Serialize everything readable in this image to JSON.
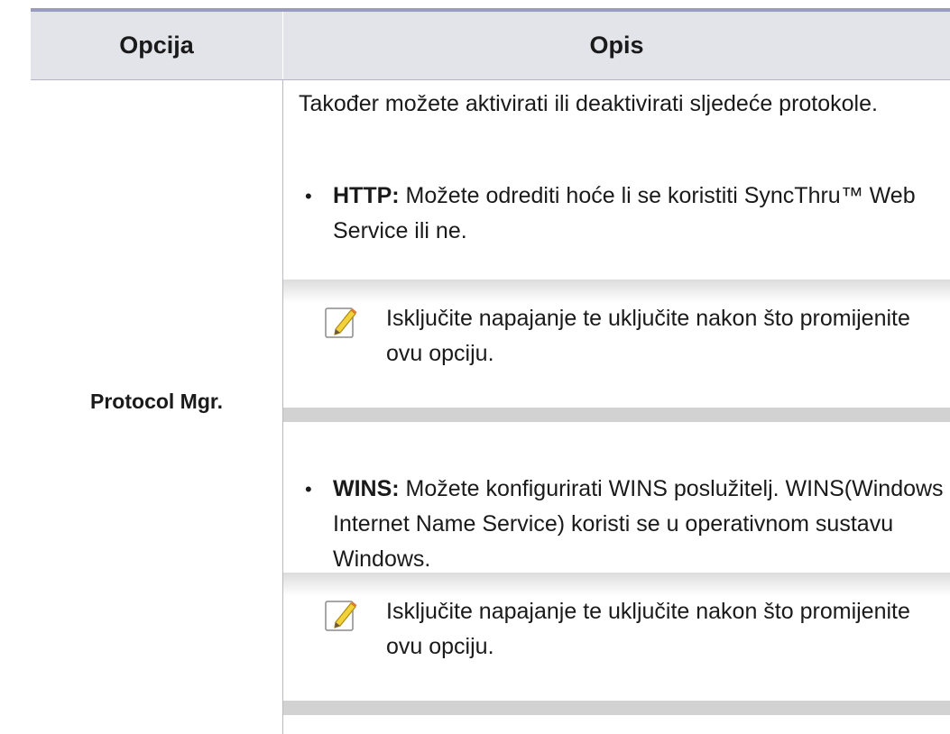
{
  "table": {
    "header": {
      "col1": "Opcija",
      "col2": "Opis"
    },
    "row": {
      "option": "Protocol Mgr.",
      "intro": "Također možete aktivirati ili deaktivirati sljedeće protokole.",
      "items": [
        {
          "label": "HTTP:",
          "text": " Možete odrediti hoće li se koristiti SyncThru™ Web Service ili ne.",
          "note": "Isključite napajanje te uključite nakon što promijenite ovu opciju."
        },
        {
          "label": "WINS:",
          "text": " Možete konfigurirati WINS poslužitelj. WINS(Windows Internet Name Service) koristi se u operativnom sustavu Windows.",
          "note": "Isključite napajanje te uključite nakon što promijenite ovu opciju."
        }
      ]
    }
  },
  "icons": {
    "note": "note-pencil-icon"
  },
  "colors": {
    "header_bg": "#e3e3ea",
    "top_rule": "#9b9bbd",
    "divider": "#b9b9c9",
    "note_band": "#d2d2d2"
  }
}
